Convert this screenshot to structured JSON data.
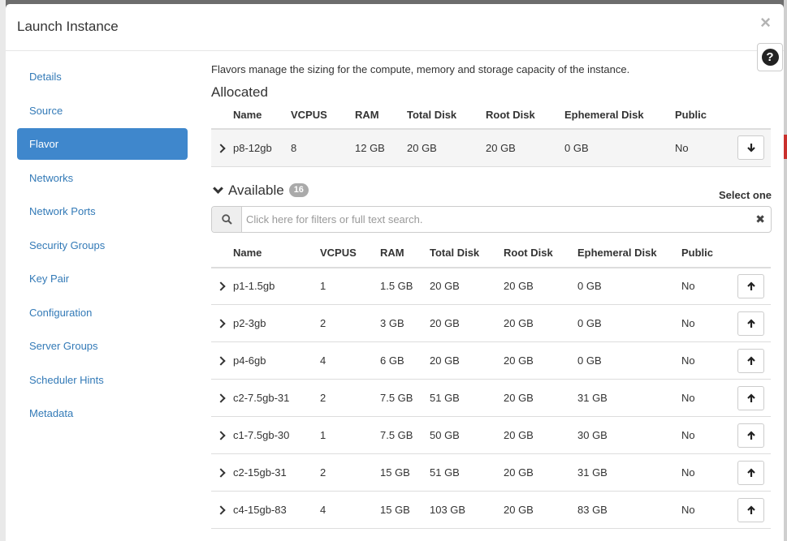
{
  "modal": {
    "title": "Launch Instance",
    "close_glyph": "×",
    "help_glyph": "?"
  },
  "sidebar": {
    "items": [
      {
        "label": "Details",
        "active": false
      },
      {
        "label": "Source",
        "active": false
      },
      {
        "label": "Flavor",
        "active": true
      },
      {
        "label": "Networks",
        "active": false
      },
      {
        "label": "Network Ports",
        "active": false
      },
      {
        "label": "Security Groups",
        "active": false
      },
      {
        "label": "Key Pair",
        "active": false
      },
      {
        "label": "Configuration",
        "active": false
      },
      {
        "label": "Server Groups",
        "active": false
      },
      {
        "label": "Scheduler Hints",
        "active": false
      },
      {
        "label": "Metadata",
        "active": false
      }
    ]
  },
  "intro": "Flavors manage the sizing for the compute, memory and storage capacity of the instance.",
  "allocated": {
    "title": "Allocated",
    "columns": [
      "Name",
      "VCPUS",
      "RAM",
      "Total Disk",
      "Root Disk",
      "Ephemeral Disk",
      "Public"
    ],
    "rows": [
      {
        "name": "p8-12gb",
        "vcpus": "8",
        "ram": "12 GB",
        "total_disk": "20 GB",
        "root_disk": "20 GB",
        "ephemeral_disk": "0 GB",
        "public": "No"
      }
    ]
  },
  "available": {
    "title": "Available",
    "count": "16",
    "select_label": "Select one",
    "search_placeholder": "Click here for filters or full text search.",
    "columns": [
      "Name",
      "VCPUS",
      "RAM",
      "Total Disk",
      "Root Disk",
      "Ephemeral Disk",
      "Public"
    ],
    "rows": [
      {
        "name": "p1-1.5gb",
        "vcpus": "1",
        "ram": "1.5 GB",
        "total_disk": "20 GB",
        "root_disk": "20 GB",
        "ephemeral_disk": "0 GB",
        "public": "No"
      },
      {
        "name": "p2-3gb",
        "vcpus": "2",
        "ram": "3 GB",
        "total_disk": "20 GB",
        "root_disk": "20 GB",
        "ephemeral_disk": "0 GB",
        "public": "No"
      },
      {
        "name": "p4-6gb",
        "vcpus": "4",
        "ram": "6 GB",
        "total_disk": "20 GB",
        "root_disk": "20 GB",
        "ephemeral_disk": "0 GB",
        "public": "No"
      },
      {
        "name": "c2-7.5gb-31",
        "vcpus": "2",
        "ram": "7.5 GB",
        "total_disk": "51 GB",
        "root_disk": "20 GB",
        "ephemeral_disk": "31 GB",
        "public": "No"
      },
      {
        "name": "c1-7.5gb-30",
        "vcpus": "1",
        "ram": "7.5 GB",
        "total_disk": "50 GB",
        "root_disk": "20 GB",
        "ephemeral_disk": "30 GB",
        "public": "No"
      },
      {
        "name": "c2-15gb-31",
        "vcpus": "2",
        "ram": "15 GB",
        "total_disk": "51 GB",
        "root_disk": "20 GB",
        "ephemeral_disk": "31 GB",
        "public": "No"
      },
      {
        "name": "c4-15gb-83",
        "vcpus": "4",
        "ram": "15 GB",
        "total_disk": "103 GB",
        "root_disk": "20 GB",
        "ephemeral_disk": "83 GB",
        "public": "No"
      }
    ]
  },
  "colors": {
    "accent": "#3f87cc",
    "link": "#337ab7"
  },
  "icons": {
    "expand": "chevron-right-icon",
    "collapse": "chevron-down-icon",
    "allocate": "arrow-up-icon",
    "deallocate": "arrow-down-icon",
    "search": "search-icon",
    "clear": "clear-icon"
  }
}
